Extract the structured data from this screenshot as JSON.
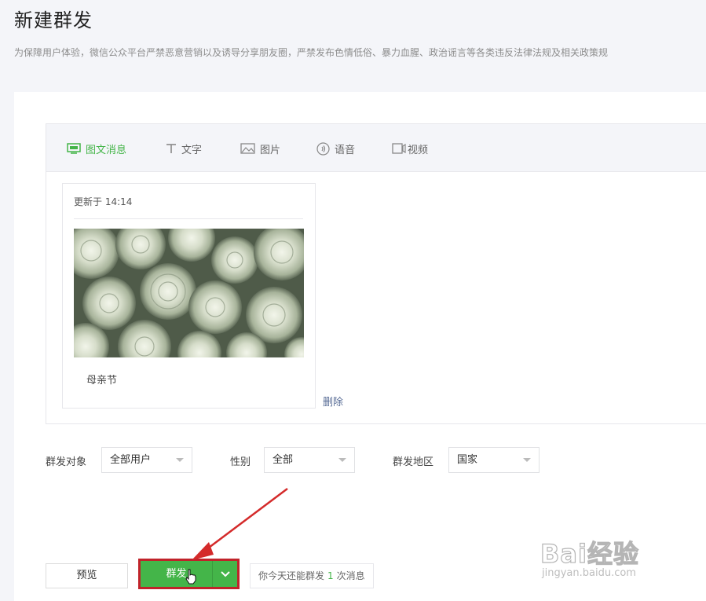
{
  "page": {
    "title": "新建群发",
    "notice": "为保障用户体验，微信公众平台严禁恶意营销以及诱导分享朋友圈，严禁发布色情低俗、暴力血腥、政治谣言等各类违反法律法规及相关政策规"
  },
  "tabs": [
    {
      "label": "图文消息",
      "icon": "news-icon"
    },
    {
      "label": "文字",
      "icon": "text-icon"
    },
    {
      "label": "图片",
      "icon": "image-icon"
    },
    {
      "label": "语音",
      "icon": "audio-icon"
    },
    {
      "label": "视频",
      "icon": "video-icon"
    }
  ],
  "article": {
    "updated": "更新于 14:14",
    "title": "母亲节",
    "delete_label": "删除"
  },
  "filters": {
    "target_label": "群发对象",
    "target_value": "全部用户",
    "gender_label": "性别",
    "gender_value": "全部",
    "region_label": "群发地区",
    "region_value": "国家"
  },
  "actions": {
    "preview_label": "预览",
    "send_label": "群发",
    "quota_prefix": "你今天还能群发",
    "quota_count": "1",
    "quota_suffix": "次消息"
  },
  "watermark": {
    "brand": "Bai经验",
    "url": "jingyan.baidu.com"
  },
  "colors": {
    "accent_green": "#44b549",
    "highlight_red": "#c0232a",
    "link_blue": "#576b95"
  }
}
